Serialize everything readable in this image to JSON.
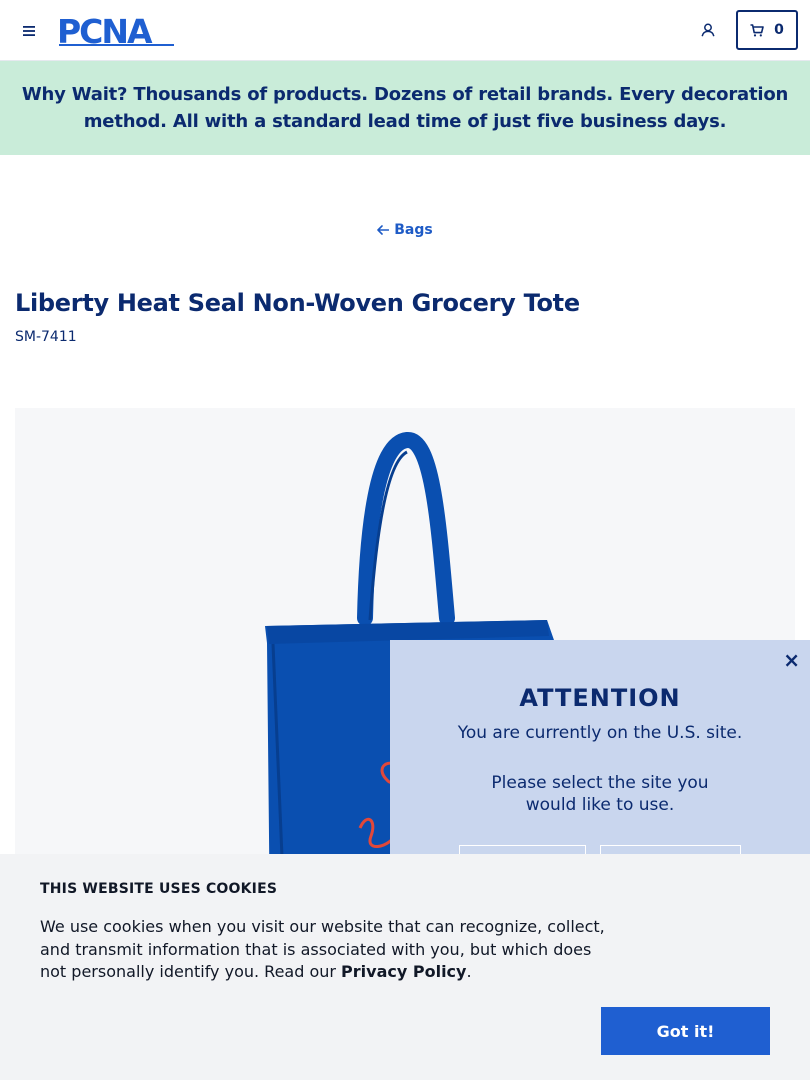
{
  "header": {
    "logo_text": "PCNA",
    "menu_icon": "hamburger-icon",
    "account_icon": "user-icon",
    "cart_icon": "cart-icon",
    "cart_count": "0"
  },
  "promo": {
    "lead": "Why Wait?",
    "text": " Thousands of products. Dozens of retail brands. Every decoration method. All with a standard lead time of just five business days."
  },
  "breadcrumb": {
    "icon": "arrow-left-icon",
    "label": "Bags"
  },
  "product": {
    "title": "Liberty Heat Seal Non-Woven Grocery Tote",
    "sku": "SM-7411",
    "image_alt": "Blue non-woven grocery tote bag",
    "bag_color": "#0a4fb0",
    "imprint_color": "#e2483a"
  },
  "site_modal": {
    "close_label": "×",
    "title": "ATTENTION",
    "message": "You are currently on the U.S. site.",
    "prompt": "Please select the site you would like to use."
  },
  "cookie_banner": {
    "title": "THIS WEBSITE USES COOKIES",
    "text": "We use cookies when you visit our website that can recognize, collect, and transmit information that is associated with you, but which does not personally identify you. Read our ",
    "link_label": "Privacy Policy",
    "text_end": ".",
    "button_label": "Got it!"
  },
  "colors": {
    "brand_navy": "#0b2a6f",
    "link_blue": "#1e5bc6",
    "promo_bg": "#c9ecd9",
    "modal_bg": "#c9d6ee",
    "cookie_button": "#1f5fd1"
  }
}
